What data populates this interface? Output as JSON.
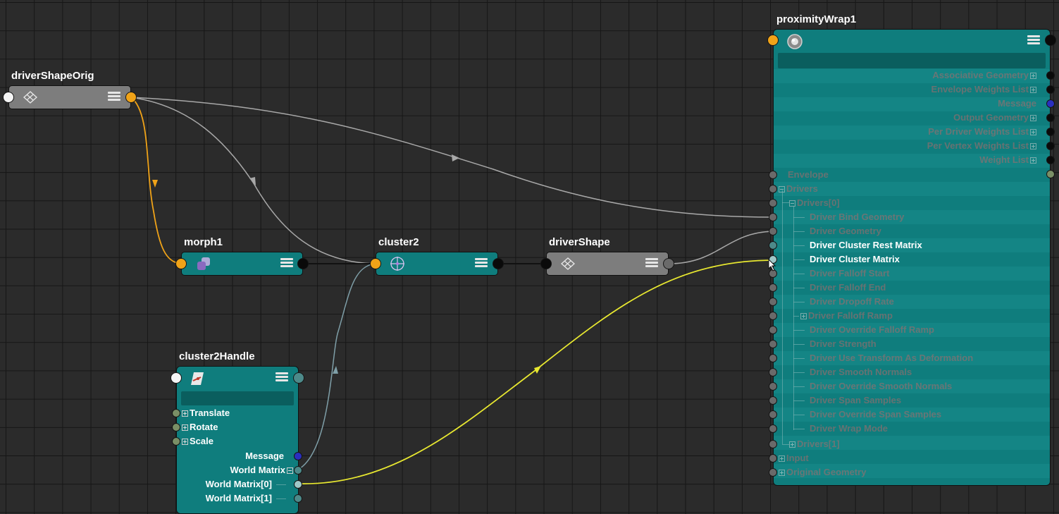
{
  "nodes": {
    "driverShapeOrig": {
      "title": "driverShapeOrig"
    },
    "morph1": {
      "title": "morph1"
    },
    "cluster2": {
      "title": "cluster2"
    },
    "driverShape": {
      "title": "driverShape"
    },
    "cluster2Handle": {
      "title": "cluster2Handle",
      "attrs": [
        "Translate",
        "Rotate",
        "Scale"
      ],
      "outputs": [
        "Message",
        "World Matrix",
        "World Matrix[0]",
        "World Matrix[1]"
      ]
    },
    "proximityWrap1": {
      "title": "proximityWrap1",
      "outputs": [
        "Associative Geometry",
        "Envelope Weights List",
        "Message",
        "Output Geometry",
        "Per Driver Weights List",
        "Per Vertex Weights List",
        "Weight List"
      ],
      "inputs": [
        "Envelope",
        "Drivers",
        "Drivers[0]",
        "Driver Bind Geometry",
        "Driver Geometry",
        "Driver Cluster Rest Matrix",
        "Driver Cluster Matrix",
        "Driver Falloff Start",
        "Driver Falloff End",
        "Driver Dropoff Rate",
        "Driver Falloff Ramp",
        "Driver Override Falloff Ramp",
        "Driver Strength",
        "Driver Use Transform As Deformation",
        "Driver Smooth Normals",
        "Driver Override Smooth Normals",
        "Driver Span Samples",
        "Driver Override Span Samples",
        "Driver Wrap Mode",
        "Drivers[1]",
        "Input",
        "Original Geometry"
      ]
    }
  },
  "colors": {
    "canvas": "#2b2b2b",
    "grid": "#161616",
    "deformer_node": "#0f7d7d",
    "shape_node": "#7d7d7d",
    "selected_wire": "#f0a318",
    "highlight_wire": "#e8e830",
    "wire": "#a8a8a8",
    "matrix_wire": "#7f9fa8"
  },
  "icons": {
    "driverShapeOrig": "mesh-icon",
    "morph1": "morph-icon",
    "cluster2": "cluster-icon",
    "driverShape": "mesh-icon",
    "cluster2Handle": "cluster-handle-icon",
    "proximityWrap1": "proximity-wrap-icon",
    "node_menu": "menu-icon"
  }
}
